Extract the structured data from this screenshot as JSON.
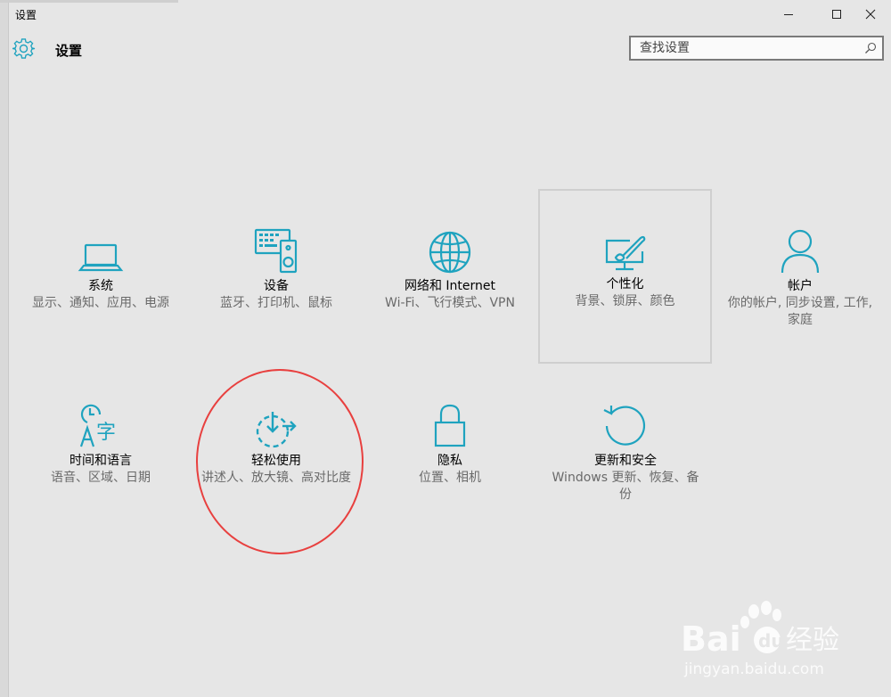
{
  "window": {
    "title": "设置",
    "controls": {
      "minimize_icon": "minimize-icon",
      "maximize_icon": "maximize-icon",
      "close_icon": "close-icon"
    }
  },
  "header": {
    "title": "设置",
    "icon": "gear-icon"
  },
  "search": {
    "placeholder": "查找设置",
    "value": "",
    "icon": "search-icon"
  },
  "accent_color": "#1fa3bf",
  "annotation_color": "#e8403f",
  "tiles": [
    {
      "id": "system",
      "title": "系统",
      "desc": "显示、通知、应用、电源",
      "icon": "laptop-icon"
    },
    {
      "id": "devices",
      "title": "设备",
      "desc": "蓝牙、打印机、鼠标",
      "icon": "devices-icon"
    },
    {
      "id": "network",
      "title": "网络和 Internet",
      "desc": "Wi-Fi、飞行模式、VPN",
      "icon": "globe-icon"
    },
    {
      "id": "personalization",
      "title": "个性化",
      "desc": "背景、锁屏、颜色",
      "icon": "paintbrush-monitor-icon"
    },
    {
      "id": "accounts",
      "title": "帐户",
      "desc": "你的帐户, 同步设置, 工作, 家庭",
      "icon": "person-icon"
    },
    {
      "id": "time-language",
      "title": "时间和语言",
      "desc": "语音、区域、日期",
      "icon": "clock-language-icon"
    },
    {
      "id": "ease-of-access",
      "title": "轻松使用",
      "desc": "讲述人、放大镜、高对比度",
      "icon": "ease-of-access-icon"
    },
    {
      "id": "privacy",
      "title": "隐私",
      "desc": "位置、相机",
      "icon": "lock-icon"
    },
    {
      "id": "update-security",
      "title": "更新和安全",
      "desc": "Windows 更新、恢复、备份",
      "icon": "refresh-icon"
    }
  ],
  "watermark": {
    "brand": "Bai",
    "brand_tail": "du",
    "product": "经验",
    "url": "jingyan.baidu.com"
  }
}
